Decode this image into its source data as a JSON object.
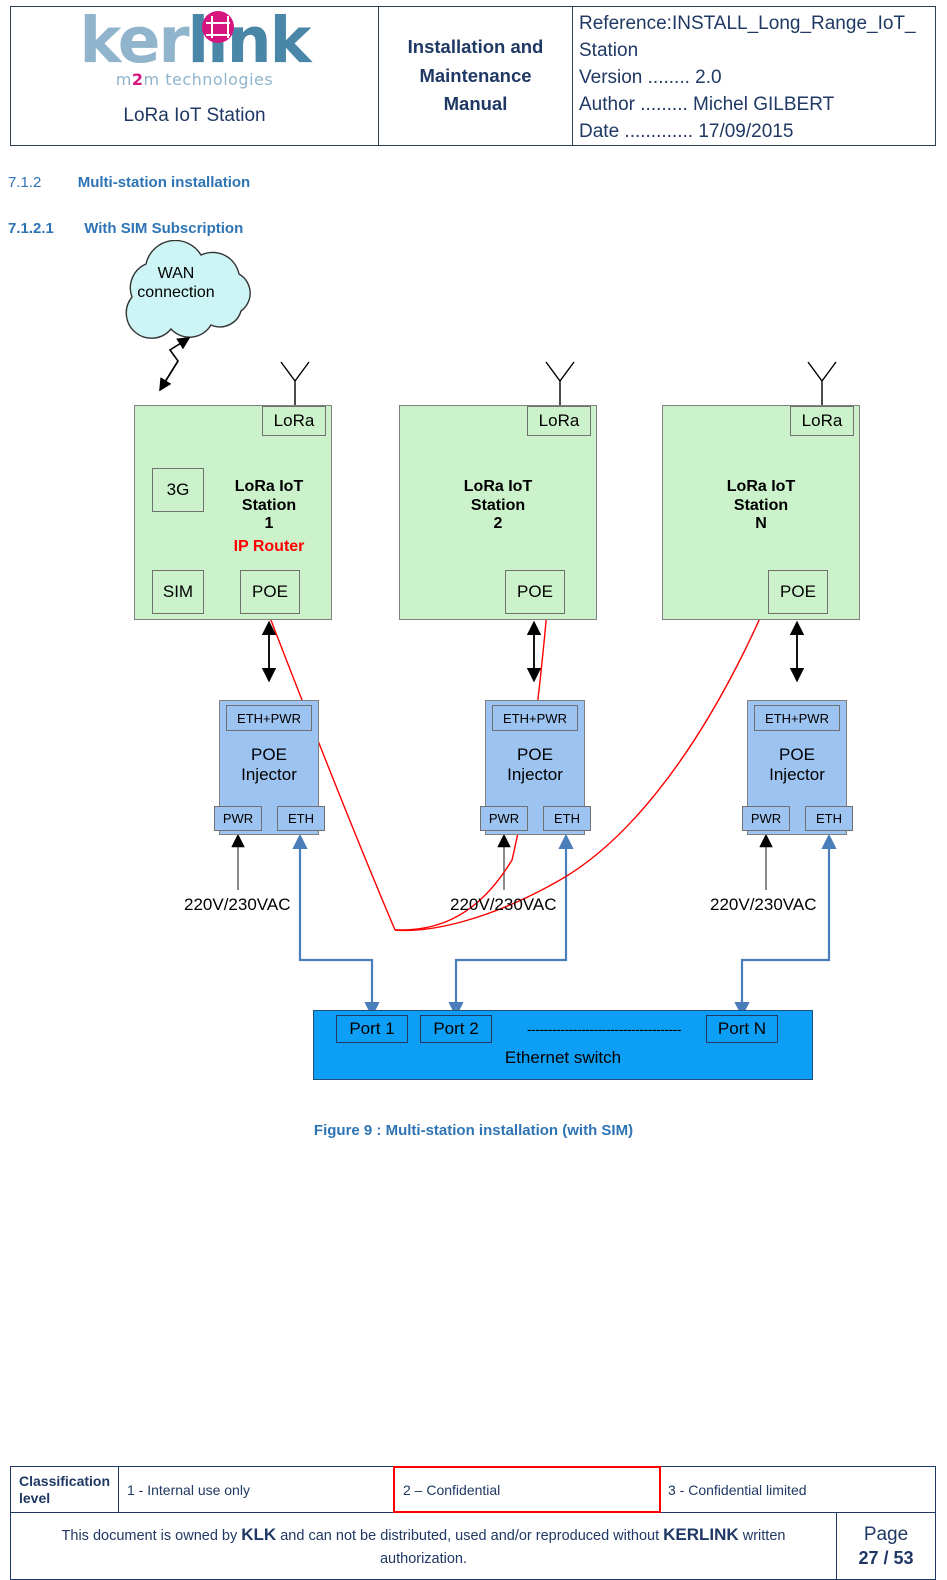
{
  "header": {
    "logo": {
      "part1": "ker",
      "part2": "link",
      "tagline_a": "m",
      "tagline_b": "2",
      "tagline_c": "m technologies",
      "subtitle": "LoRa IoT Station"
    },
    "doc_title": "Installation and\nMaintenance\nManual",
    "reference": "Reference:INSTALL_Long_Range_IoT_",
    "reference_cont": "Station",
    "version": "Version ........ 2.0",
    "author": "Author ......... Michel GILBERT",
    "date": "Date ............. 17/09/2015"
  },
  "headings": {
    "h3_number": "7.1.2",
    "h3_text": "Multi-station installation",
    "h4_number": "7.1.2.1",
    "h4_text": "With SIM Subscription"
  },
  "diagram": {
    "cloud_label": "WAN\nconnection",
    "stations": [
      {
        "title": "LoRa IoT\nStation\n1",
        "extra_label": "IP Router",
        "lora_label": "LoRa",
        "modules": [
          {
            "name": "3G"
          },
          {
            "name": "SIM"
          },
          {
            "name": "POE"
          }
        ]
      },
      {
        "title": "LoRa IoT\nStation\n2",
        "extra_label": "",
        "lora_label": "LoRa",
        "modules": [
          {
            "name": "POE"
          }
        ]
      },
      {
        "title": "LoRa IoT\nStation\nN",
        "extra_label": "",
        "lora_label": "LoRa",
        "modules": [
          {
            "name": "POE"
          }
        ]
      }
    ],
    "injectors": [
      {
        "top_port": "ETH+PWR",
        "title": "POE\nInjector",
        "left_port": "PWR",
        "right_port": "ETH",
        "supply": "220V/230VAC"
      },
      {
        "top_port": "ETH+PWR",
        "title": "POE\nInjector",
        "left_port": "PWR",
        "right_port": "ETH",
        "supply": "220V/230VAC"
      },
      {
        "top_port": "ETH+PWR",
        "title": "POE\nInjector",
        "left_port": "PWR",
        "right_port": "ETH",
        "supply": "220V/230VAC"
      }
    ],
    "switch": {
      "title": "Ethernet switch",
      "ports": [
        "Port 1",
        "Port 2",
        "Port N"
      ],
      "ellipsis": "-------------------------------------"
    },
    "figure_caption": "Figure 9 : Multi-station installation (with SIM)"
  },
  "footer": {
    "classification_label": "Classification\nlevel",
    "level1": "1 - Internal use only",
    "level2": "2 – Confidential",
    "level3": "3 - Confidential limited",
    "notice_pre": "This document is owned by ",
    "notice_klk": "KLK",
    "notice_mid": " and can not be distributed, used and/or reproduced  without ",
    "notice_kerlink": "KERLINK",
    "notice_post": "  written authorization.",
    "page_label": "Page",
    "page_value": "27 / 53"
  },
  "colors": {
    "heading_blue": "#2e74b5",
    "doc_navy": "#1f3864",
    "station_green": "#ccf2cc",
    "injector_blue": "#9dc3f0",
    "switch_blue": "#0d9ef5",
    "accent_red": "#ff0000",
    "logo_pink": "#d6157f",
    "logo_teal": "#4a86a8",
    "cloud_cyan": "#cdf5f5"
  }
}
